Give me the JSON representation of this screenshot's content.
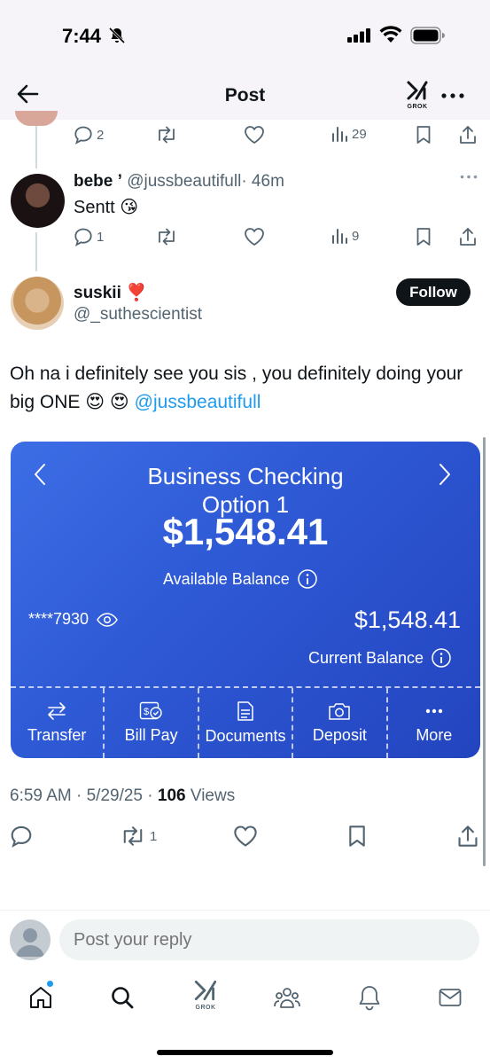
{
  "status_bar": {
    "time": "7:44"
  },
  "header": {
    "title": "Post",
    "grok_label": "GROK"
  },
  "prev_tweet_actions": {
    "replies": "2",
    "views": "29"
  },
  "reply": {
    "display_name": "bebe ’",
    "handle": "@jussbeautifull",
    "time": "· 46m",
    "text": "Sentt 😘",
    "replies": "1",
    "views": "9"
  },
  "main_tweet": {
    "display_name": "suskii ❣️",
    "handle": "@_suthescientist",
    "follow_label": "Follow",
    "text": "Oh na i definitely see you sis , you definitely doing your big ONE 😍 😍",
    "mention": "@jussbeautifull",
    "timestamp": "6:59 AM · 5/29/25 ·",
    "views_count": "106",
    "views_label": "Views",
    "reposts": "1"
  },
  "bank_card": {
    "account_title": "Business Checking Option 1",
    "balance": "$1,548.41",
    "available_label": "Available Balance",
    "account_mask": "****7930",
    "current_amount": "$1,548.41",
    "current_label": "Current Balance",
    "actions": [
      {
        "label": "Transfer",
        "icon": "transfer-icon"
      },
      {
        "label": "Bill Pay",
        "icon": "bill-pay-icon"
      },
      {
        "label": "Documents",
        "icon": "documents-icon"
      },
      {
        "label": "Deposit",
        "icon": "deposit-icon"
      },
      {
        "label": "More",
        "icon": "more-icon"
      }
    ]
  },
  "reply_box": {
    "placeholder": "Post your reply"
  },
  "tabbar": {
    "grok_label": "GROK",
    "items": [
      "home-icon",
      "search-icon",
      "grok-icon",
      "communities-icon",
      "notifications-icon",
      "messages-icon"
    ]
  },
  "colors": {
    "link": "#1d9bf0",
    "muted": "#536471",
    "bank_blue": "#2f5ad6"
  }
}
